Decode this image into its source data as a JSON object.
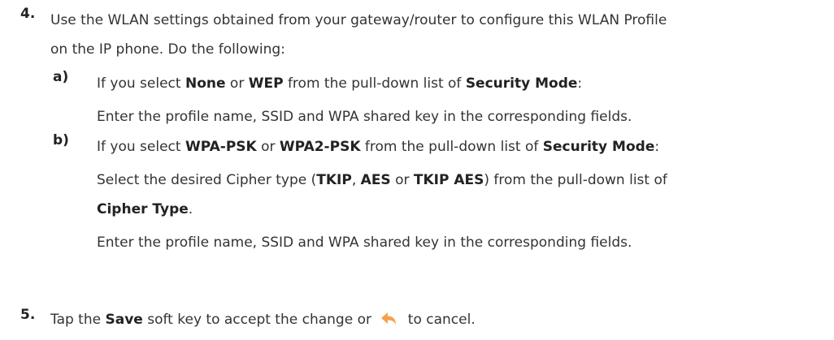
{
  "step4": {
    "number": "4.",
    "line1": "Use the WLAN settings obtained from your gateway/router to configure this WLAN Profile",
    "line2": "on the IP phone. Do the following:"
  },
  "substep_a": {
    "letter": "a)",
    "intro_prefix": "If you select ",
    "opt1": "None",
    "or1": " or ",
    "opt2": "WEP",
    "mid": " from the pull-down list of ",
    "field": "Security Mode",
    "end": ":",
    "instruction": "Enter the profile name, SSID and WPA shared key in the corresponding fields."
  },
  "substep_b": {
    "letter": "b)",
    "intro_prefix": "If you select ",
    "opt1": "WPA-PSK",
    "or1": " or ",
    "opt2": "WPA2-PSK",
    "mid": " from the pull-down list of ",
    "field": "Security Mode",
    "end": ":",
    "cipher_prefix": "Select the desired Cipher type (",
    "cipher1": "TKIP",
    "cipher_sep1": ", ",
    "cipher2": "AES",
    "cipher_sep2": " or ",
    "cipher3": "TKIP AES",
    "cipher_suffix": ") from the pull-down list of",
    "cipher_field": "Cipher Type",
    "cipher_end": ".",
    "instruction": "Enter the profile name, SSID and WPA shared key in the corresponding fields."
  },
  "step5": {
    "number": "5.",
    "prefix": "Tap the ",
    "key": "Save",
    "middle": " soft key to accept the change or ",
    "suffix": " to cancel.",
    "icon_name": "back-arrow-icon",
    "icon_color": "#F5A04B"
  }
}
